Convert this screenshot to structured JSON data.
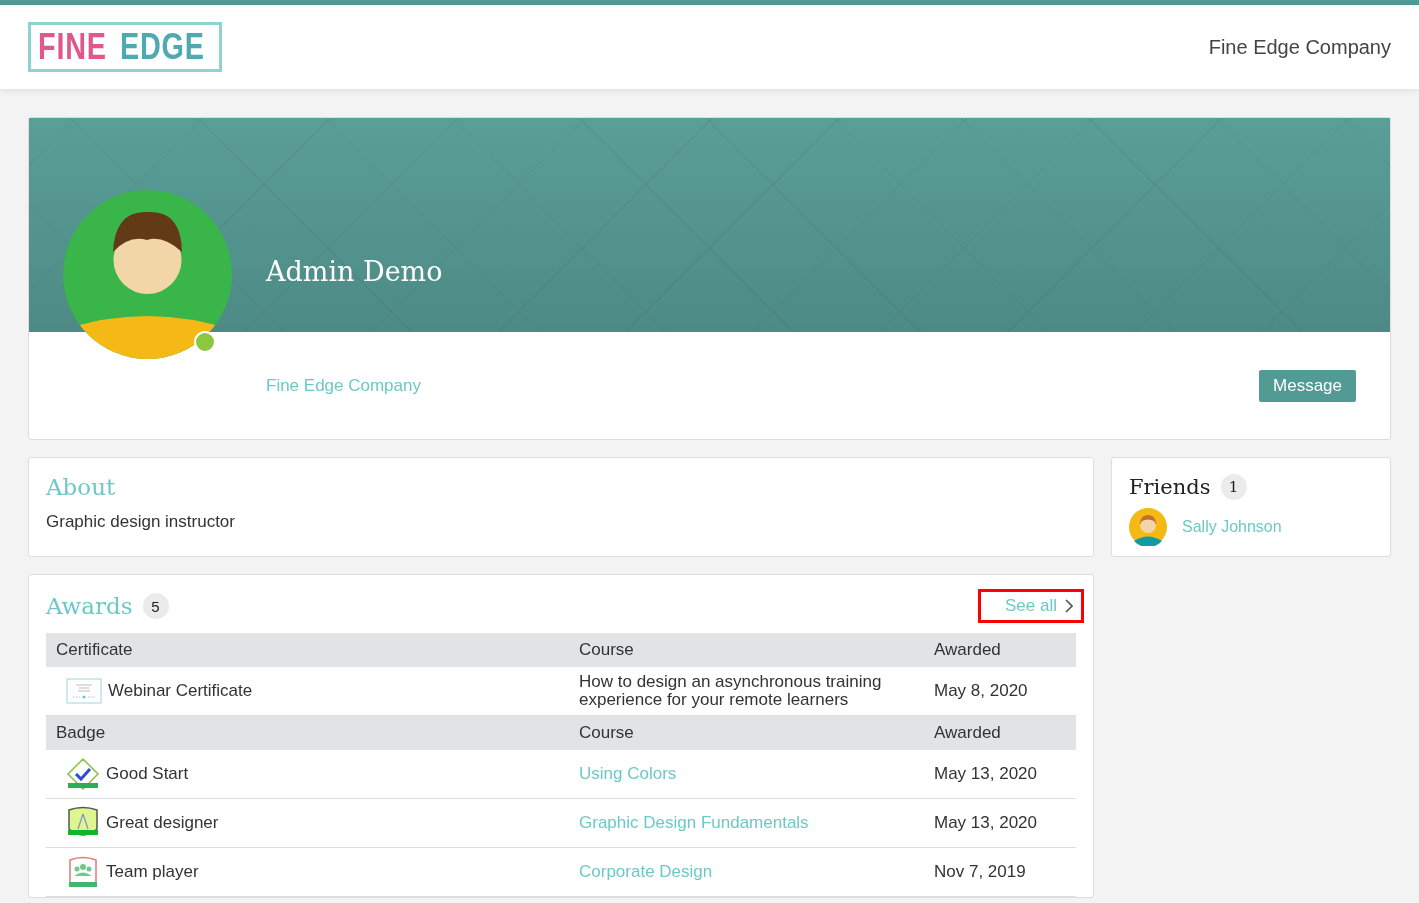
{
  "header": {
    "logo": {
      "word_1": "FINE",
      "word_2": "EDGE"
    },
    "company": "Fine Edge Company"
  },
  "profile": {
    "name": "Admin Demo",
    "online": true,
    "company": "Fine Edge Company",
    "message_button": "Message"
  },
  "about": {
    "title": "About",
    "text": "Graphic design instructor"
  },
  "friends": {
    "title": "Friends",
    "count": "1",
    "items": [
      {
        "name": "Sally Johnson"
      }
    ]
  },
  "awards": {
    "title": "Awards",
    "count": "5",
    "see_all": {
      "label": "See all",
      "highlighted": true
    },
    "sections": [
      {
        "columns": [
          "Certificate",
          "Course",
          "Awarded"
        ],
        "rows": [
          {
            "kind": "certificate",
            "name": "Webinar Certificate",
            "course": "How to design an asynchronous training experience for your remote learners",
            "linked": false,
            "awarded": "May 8, 2020"
          }
        ]
      },
      {
        "columns": [
          "Badge",
          "Course",
          "Awarded"
        ],
        "rows": [
          {
            "kind": "check",
            "name": "Good Start",
            "course": "Using Colors",
            "linked": true,
            "awarded": "May 13, 2020"
          },
          {
            "kind": "shield",
            "name": "Great designer",
            "course": "Graphic Design Fundamentals",
            "linked": true,
            "awarded": "May 13, 2020"
          },
          {
            "kind": "team",
            "name": "Team player",
            "course": "Corporate Design",
            "linked": true,
            "awarded": "Nov 7, 2019"
          }
        ]
      }
    ]
  }
}
